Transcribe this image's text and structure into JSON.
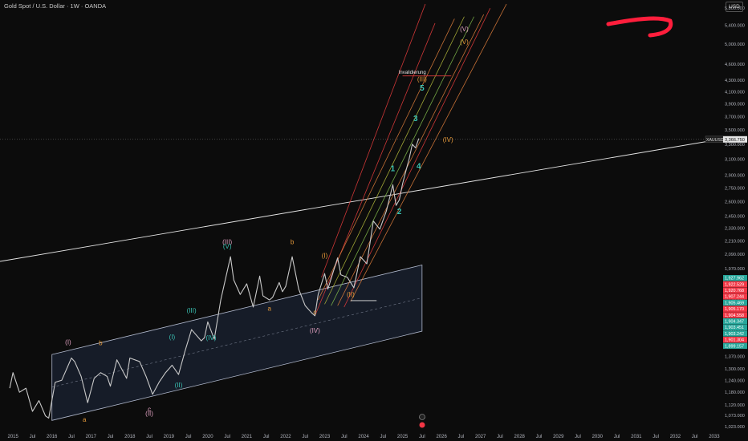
{
  "header": {
    "title": "Gold Spot / U.S. Dollar · 1W · OANDA",
    "currency": "USD"
  },
  "colors": {
    "background": "#0c0c0c",
    "axis_text": "#b2b5be",
    "candles": "#c9c9c9",
    "teal": "#3ac2b3",
    "orange": "#e69a3a",
    "pink": "#e0a0c0",
    "red": "#e03b3b",
    "channel_fill": "#1a2232",
    "channel_line": "#b0b8cc",
    "white_line": "#e5e5e5",
    "price_tag_green": "#26a69a",
    "price_tag_red": "#f23645"
  },
  "chart_data": {
    "type": "line",
    "symbol": "XAUUSD",
    "x_ticks": [
      "2015",
      "Jul",
      "2016",
      "Jul",
      "2017",
      "Jul",
      "2018",
      "Jul",
      "2019",
      "Jul",
      "2020",
      "Jul",
      "2021",
      "Jul",
      "2022",
      "Jul",
      "2023",
      "Jul",
      "2024",
      "Jul",
      "2025",
      "Jul",
      "2026",
      "Jul",
      "2027",
      "Jul",
      "2028",
      "Jul",
      "2029",
      "Jul",
      "2030",
      "Jul",
      "2031",
      "Jul",
      "2032",
      "Jul",
      "2033"
    ],
    "y_ticks": [
      "5,800.000",
      "5,400.000",
      "5,000.000",
      "4,600.000",
      "4,300.000",
      "4,100.000",
      "3,900.000",
      "3,700.000",
      "3,500.000",
      "3,300.000",
      "3,100.000",
      "2,900.000",
      "2,750.000",
      "2,600.000",
      "2,450.000",
      "2,330.000",
      "2,210.000",
      "2,090.000",
      "1,970.000",
      "1,850.000",
      "1,740.000",
      "1,630.000",
      "1,530.000",
      "1,430.000",
      "1,370.000",
      "1,300.000",
      "1,240.000",
      "1,180.000",
      "1,120.000",
      "1,073.000",
      "1,023.000"
    ],
    "y_scale": "log",
    "ylim": [
      1010,
      6000
    ],
    "xlim": [
      "2014-09",
      "2033-03"
    ],
    "series": [
      {
        "values": [
          [
            "2014-12",
            1200
          ],
          [
            "2015-01",
            1280
          ],
          [
            "2015-03",
            1180
          ],
          [
            "2015-05",
            1200
          ],
          [
            "2015-07",
            1090
          ],
          [
            "2015-09",
            1140
          ],
          [
            "2015-11",
            1070
          ],
          [
            "2015-12",
            1060
          ],
          [
            "2016-02",
            1230
          ],
          [
            "2016-04",
            1240
          ],
          [
            "2016-07",
            1360
          ],
          [
            "2016-08",
            1340
          ],
          [
            "2016-10",
            1260
          ],
          [
            "2016-12",
            1130
          ],
          [
            "2017-02",
            1250
          ],
          [
            "2017-04",
            1280
          ],
          [
            "2017-06",
            1260
          ],
          [
            "2017-07",
            1210
          ],
          [
            "2017-09",
            1350
          ],
          [
            "2017-12",
            1250
          ],
          [
            "2018-01",
            1360
          ],
          [
            "2018-04",
            1340
          ],
          [
            "2018-06",
            1260
          ],
          [
            "2018-08",
            1170
          ],
          [
            "2018-10",
            1230
          ],
          [
            "2018-12",
            1280
          ],
          [
            "2019-02",
            1320
          ],
          [
            "2019-04",
            1270
          ],
          [
            "2019-06",
            1400
          ],
          [
            "2019-08",
            1530
          ],
          [
            "2019-11",
            1460
          ],
          [
            "2019-12",
            1480
          ],
          [
            "2020-01",
            1580
          ],
          [
            "2020-03",
            1470
          ],
          [
            "2020-05",
            1730
          ],
          [
            "2020-08",
            2070
          ],
          [
            "2020-09",
            1880
          ],
          [
            "2020-11",
            1770
          ],
          [
            "2021-01",
            1850
          ],
          [
            "2021-03",
            1680
          ],
          [
            "2021-05",
            1910
          ],
          [
            "2021-06",
            1760
          ],
          [
            "2021-08",
            1730
          ],
          [
            "2021-09",
            1750
          ],
          [
            "2021-11",
            1860
          ],
          [
            "2021-12",
            1790
          ],
          [
            "2022-01",
            1830
          ],
          [
            "2022-03",
            2070
          ],
          [
            "2022-05",
            1810
          ],
          [
            "2022-07",
            1690
          ],
          [
            "2022-09",
            1640
          ],
          [
            "2022-10",
            1620
          ],
          [
            "2022-11",
            1770
          ],
          [
            "2023-01",
            1930
          ],
          [
            "2023-02",
            1810
          ],
          [
            "2023-05",
            2060
          ],
          [
            "2023-06",
            1920
          ],
          [
            "2023-08",
            1900
          ],
          [
            "2023-10",
            1820
          ],
          [
            "2023-12",
            2070
          ],
          [
            "2024-02",
            2010
          ],
          [
            "2024-04",
            2400
          ],
          [
            "2024-06",
            2320
          ],
          [
            "2024-08",
            2500
          ],
          [
            "2024-10",
            2790
          ],
          [
            "2024-11",
            2560
          ],
          [
            "2024-12",
            2620
          ],
          [
            "2025-01",
            2800
          ],
          [
            "2025-02",
            2950
          ],
          [
            "2025-03",
            3100
          ],
          [
            "2025-04",
            3300
          ],
          [
            "2025-05",
            3250
          ],
          [
            "2025-06",
            3380
          ]
        ]
      }
    ],
    "current_price": {
      "value": 3366.75,
      "label": "3,366.750",
      "symbol_tag": "XAUUSD"
    },
    "price_tags": [
      {
        "label": "1,927.962",
        "color": "green"
      },
      {
        "label": "1,922.529",
        "color": "red"
      },
      {
        "label": "1,920.768",
        "color": "red"
      },
      {
        "label": "1,907.244",
        "color": "red"
      },
      {
        "label": "1,905.469",
        "color": "green"
      },
      {
        "label": "1,905.170",
        "color": "red"
      },
      {
        "label": "1,904.558",
        "color": "red"
      },
      {
        "label": "1,904.347",
        "color": "green"
      },
      {
        "label": "1,903.451",
        "color": "green"
      },
      {
        "label": "1,903.242",
        "color": "green"
      },
      {
        "label": "1,901.304",
        "color": "red"
      },
      {
        "label": "1,899.157",
        "color": "green"
      }
    ],
    "annotations": [
      {
        "text": "(I)",
        "x": "2016-06",
        "y": 1440,
        "color": "pink"
      },
      {
        "text": "b",
        "x": "2017-04",
        "y": 1435,
        "color": "orange"
      },
      {
        "text": "a",
        "x": "2016-11",
        "y": 1045,
        "color": "orange"
      },
      {
        "text": "c",
        "x": "2018-07",
        "y": 1090,
        "color": "pink"
      },
      {
        "text": "(II)",
        "x": "2018-07",
        "y": 1070,
        "color": "pink"
      },
      {
        "text": "(I)",
        "x": "2019-02",
        "y": 1470,
        "color": "teal"
      },
      {
        "text": "(II)",
        "x": "2019-04",
        "y": 1205,
        "color": "teal"
      },
      {
        "text": "(III)",
        "x": "2019-08",
        "y": 1640,
        "color": "teal"
      },
      {
        "text": "(IV)",
        "x": "2020-02",
        "y": 1465,
        "color": "teal"
      },
      {
        "text": "(III)",
        "x": "2020-07",
        "y": 2180,
        "color": "pink"
      },
      {
        "text": "(V)",
        "x": "2020-07",
        "y": 2140,
        "color": "teal"
      },
      {
        "text": "b",
        "x": "2022-03",
        "y": 2180,
        "color": "orange"
      },
      {
        "text": "a",
        "x": "2021-08",
        "y": 1655,
        "color": "orange"
      },
      {
        "text": "c",
        "x": "2022-10",
        "y": 1630,
        "color": "orange"
      },
      {
        "text": "(IV)",
        "x": "2022-10",
        "y": 1510,
        "color": "pink"
      },
      {
        "text": "(I)",
        "x": "2023-01",
        "y": 2060,
        "color": "orange"
      },
      {
        "text": "(II)",
        "x": "2023-09",
        "y": 1755,
        "color": "orange"
      },
      {
        "text": "1",
        "x": "2024-10",
        "y": 2950,
        "color": "teal"
      },
      {
        "text": "2",
        "x": "2024-12",
        "y": 2470,
        "color": "teal"
      },
      {
        "text": "3",
        "x": "2025-05",
        "y": 3630,
        "color": "teal"
      },
      {
        "text": "4",
        "x": "2025-06",
        "y": 2980,
        "color": "teal"
      },
      {
        "text": "5",
        "x": "2025-07",
        "y": 4120,
        "color": "teal"
      },
      {
        "text": "(IV)",
        "x": "2026-03",
        "y": 3330,
        "color": "orange"
      },
      {
        "text": "(III)",
        "x": "2025-07",
        "y": 4280,
        "color": "orange"
      },
      {
        "text": "(V)",
        "x": "2026-08",
        "y": 5000,
        "color": "orange"
      },
      {
        "text": "(V)",
        "x": "2026-08",
        "y": 5270,
        "color": "pink"
      },
      {
        "text": "Invalidierung",
        "x": "2025-04",
        "y": 4420,
        "color": "white"
      }
    ]
  }
}
